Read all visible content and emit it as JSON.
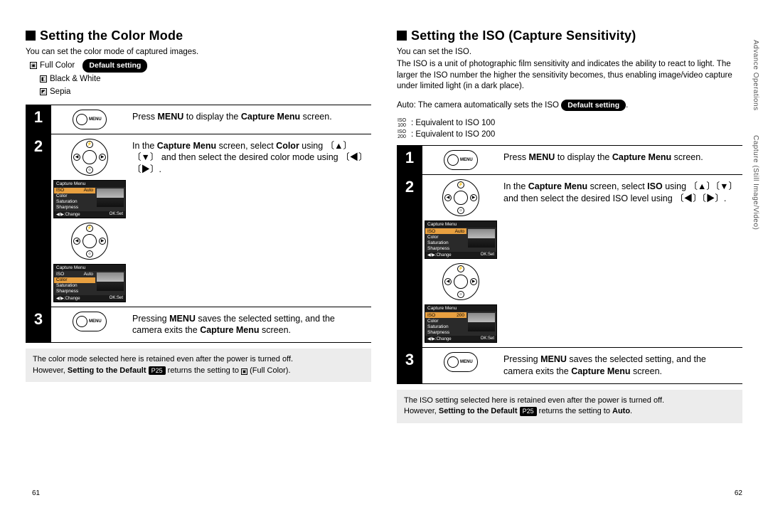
{
  "left": {
    "heading": "Setting the Color Mode",
    "intro": "You can set the color mode of captured images.",
    "options": {
      "full_color": "Full Color",
      "default_pill": "Default setting",
      "bw": "Black & White",
      "sepia": "Sepia"
    },
    "steps": {
      "s1": {
        "num": "1",
        "text_a": "Press ",
        "menu": "MENU",
        "text_b": " to display the ",
        "cap": "Capture Menu",
        "text_c": " screen.",
        "btn": "MENU"
      },
      "s2": {
        "num": "2",
        "text_a": "In the ",
        "cap": "Capture Menu",
        "text_b": " screen, select ",
        "color": "Color",
        "text_c": " using 〔▲〕〔▼〕 and then select the desired color mode using 〔◀〕〔▶〕."
      },
      "s3": {
        "num": "3",
        "text_a": "Pressing ",
        "menu": "MENU",
        "text_b": " saves the selected setting, and the camera exits the ",
        "cap": "Capture Menu",
        "text_c": " screen.",
        "btn": "MENU"
      }
    },
    "lcd1": {
      "title": "Capture Menu",
      "items": [
        "ISO",
        "Color",
        "Saturation",
        "Sharpness"
      ],
      "vals": [
        "Auto",
        "",
        "",
        ""
      ],
      "hl": 0,
      "foot_l": "◀/▶:Change",
      "foot_r": "OK:Set"
    },
    "lcd2": {
      "title": "Capture Menu",
      "items": [
        "ISO",
        "Color",
        "Saturation",
        "Sharpness"
      ],
      "vals": [
        "Auto",
        "",
        "",
        ""
      ],
      "hl": 1,
      "foot_l": "◀/▶:Change",
      "foot_r": "OK:Set"
    },
    "note": {
      "line1": "The color mode selected here is retained even after the power is turned off.",
      "line2_a": "However, ",
      "line2_b": "Setting to the Default",
      "pref": "P25",
      "line2_c": " returns the setting to ",
      "line2_d": "(Full Color)."
    },
    "pagenum": "61"
  },
  "right": {
    "heading": "Setting the ISO (Capture Sensitivity)",
    "intro": "You can set the ISO.",
    "body": "The ISO is a unit of photographic film sensitivity and indicates the ability to react to light. The larger the ISO number the higher the sensitivity becomes, thus enabling image/video capture under limited light (in a dark place).",
    "auto_a": "Auto: The camera automatically sets the ISO ",
    "auto_pill": "Default setting",
    "auto_b": ".",
    "iso100_ic": "ISO\n100",
    "iso100": ": Equivalent to ISO 100",
    "iso200_ic": "ISO\n200",
    "iso200": ": Equivalent to ISO 200",
    "steps": {
      "s1": {
        "num": "1",
        "text_a": "Press ",
        "menu": "MENU",
        "text_b": " to display the ",
        "cap": "Capture Menu",
        "text_c": " screen.",
        "btn": "MENU"
      },
      "s2": {
        "num": "2",
        "text_a": "In the ",
        "cap": "Capture Menu",
        "text_b": " screen, select ",
        "iso": "ISO",
        "text_c": " using 〔▲〕〔▼〕 and then select the desired ISO level using 〔◀〕〔▶〕."
      },
      "s3": {
        "num": "3",
        "text_a": "Pressing ",
        "menu": "MENU",
        "text_b": " saves the selected setting, and the camera exits the ",
        "cap": "Capture Menu",
        "text_c": " screen.",
        "btn": "MENU"
      }
    },
    "lcd1": {
      "title": "Capture Menu",
      "items": [
        "ISO",
        "Color",
        "Saturation",
        "Sharpness"
      ],
      "vals": [
        "Auto",
        "",
        "",
        ""
      ],
      "hl": 0,
      "foot_l": "◀/▶:Change",
      "foot_r": "OK:Set"
    },
    "lcd2": {
      "title": "Capture Menu",
      "items": [
        "ISO",
        "Color",
        "Saturation",
        "Sharpness"
      ],
      "vals": [
        "200",
        "",
        "",
        ""
      ],
      "hl": 0,
      "foot_l": "◀/▶:Change",
      "foot_r": "OK:Set"
    },
    "note": {
      "line1": "The ISO setting selected here is retained even after the power is turned off.",
      "line2_a": "However, ",
      "line2_b": "Setting to the Default",
      "pref": "P25",
      "line2_c": " returns the setting to ",
      "line2_d": "Auto",
      "line2_e": "."
    },
    "pagenum": "62",
    "tab1": "Advance Operations",
    "tab2": "Capture (Still Image/Video)"
  }
}
